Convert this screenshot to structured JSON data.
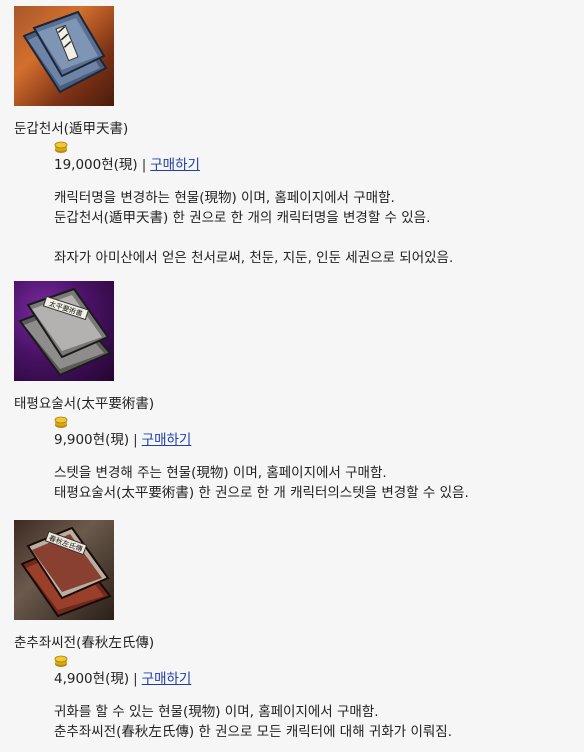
{
  "items": [
    {
      "name": "둔갑천서(遁甲天書)",
      "price": "19,000현(現)",
      "separator": "|",
      "buy_label": "구매하기",
      "desc": [
        "캐릭터명을 변경하는 현물(現物) 이며, 홈페이지에서 구매함.",
        "둔갑천서(遁甲天書) 한 권으로 한 개의 캐릭터명을 변경할 수 있음.",
        "좌자가 아미산에서 얻은 천서로써, 천둔, 지둔, 인둔 세권으로 되어있음."
      ]
    },
    {
      "name": "태평요술서(太平要術書)",
      "price": "9,900현(現)",
      "separator": "|",
      "buy_label": "구매하기",
      "desc": [
        "스텟을 변경해 주는 현물(現物) 이며, 홈페이지에서 구매함.",
        "태평요술서(太平要術書) 한 권으로 한 개 캐릭터의스텟을 변경할 수 있음."
      ],
      "book_label": "太平要術書"
    },
    {
      "name": "춘추좌씨전(春秋左氏傳)",
      "price": "4,900현(現)",
      "separator": "|",
      "buy_label": "구매하기",
      "desc": [
        "귀화를 할 수 있는 현물(現物) 이며, 홈페이지에서 구매함.",
        "춘추좌씨전(春秋左氏傳) 한 권으로 모든 캐릭터에 대해 귀화가 이뤄짐."
      ],
      "book_label": "春秋左氏傳"
    }
  ],
  "icons": {
    "coin": "gold-coin-icon",
    "item_images": [
      "blue-book-item-icon",
      "stone-book-item-icon",
      "red-book-item-icon"
    ]
  },
  "colors": {
    "link": "#1f3fa8",
    "background": "#f6f6f6",
    "coin": "#e2b21c"
  }
}
